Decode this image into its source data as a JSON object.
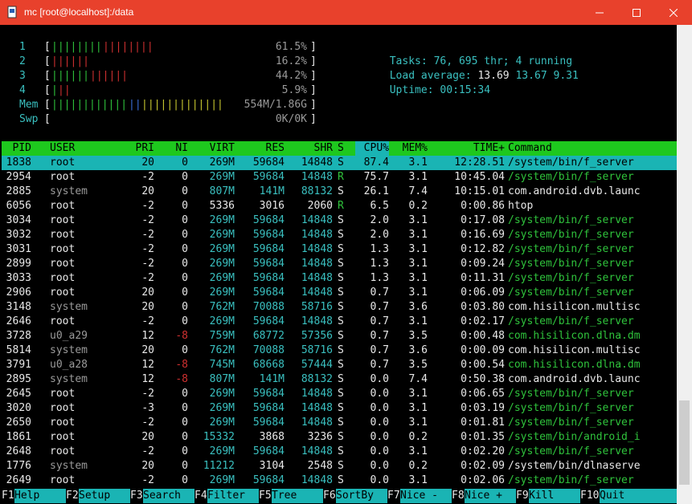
{
  "window": {
    "title": "mc [root@localhost]:/data",
    "icons": [
      "app-icon",
      "minimize-icon",
      "maximize-icon",
      "close-icon"
    ],
    "colors": {
      "titlebar": "#e8412c",
      "header": "#1ec81e",
      "selected": "#1ab4b4"
    }
  },
  "meters": {
    "cpus": [
      {
        "label": "1",
        "green": 8,
        "red": 8,
        "value": "61.5%"
      },
      {
        "label": "2",
        "green": 0,
        "red": 6,
        "value": "16.2%"
      },
      {
        "label": "3",
        "green": 6,
        "red": 6,
        "value": "44.2%"
      },
      {
        "label": "4",
        "green": 1,
        "red": 2,
        "value": "5.9%"
      }
    ],
    "mem": {
      "label": "Mem",
      "value": "554M/1.86G"
    },
    "swp": {
      "label": "Swp",
      "value": "0K/0K"
    }
  },
  "summary": {
    "tasks_label": "Tasks:",
    "tasks": "76,",
    "threads": "695",
    "thr_label": "thr;",
    "running": "4",
    "running_label": "running",
    "load_label": "Load average:",
    "load1": "13.69",
    "load5": "13.67",
    "load15": "9.31",
    "uptime_label": "Uptime:",
    "uptime": "00:15:34"
  },
  "columns": [
    "PID",
    "USER",
    "PRI",
    "NI",
    "VIRT",
    "RES",
    "SHR",
    "S",
    "CPU%",
    "MEM%",
    "TIME+",
    "Command"
  ],
  "processes": [
    [
      "1838",
      "root",
      "20",
      "0",
      "269M",
      "59684",
      "14848",
      "S",
      "87.4",
      "3.1",
      "12:28.51",
      "/system/bin/f_server"
    ],
    [
      "2954",
      "root",
      "-2",
      "0",
      "269M",
      "59684",
      "14848",
      "R",
      "75.7",
      "3.1",
      "10:45.04",
      "/system/bin/f_server"
    ],
    [
      "2885",
      "system",
      "20",
      "0",
      "807M",
      "141M",
      "88132",
      "S",
      "26.1",
      "7.4",
      "10:15.01",
      "com.android.dvb.launc"
    ],
    [
      "6056",
      "root",
      "-2",
      "0",
      "5336",
      "3016",
      "2060",
      "R",
      "6.5",
      "0.2",
      "0:00.86",
      "htop"
    ],
    [
      "3034",
      "root",
      "-2",
      "0",
      "269M",
      "59684",
      "14848",
      "S",
      "2.0",
      "3.1",
      "0:17.08",
      "/system/bin/f_server"
    ],
    [
      "3032",
      "root",
      "-2",
      "0",
      "269M",
      "59684",
      "14848",
      "S",
      "2.0",
      "3.1",
      "0:16.69",
      "/system/bin/f_server"
    ],
    [
      "3031",
      "root",
      "-2",
      "0",
      "269M",
      "59684",
      "14848",
      "S",
      "1.3",
      "3.1",
      "0:12.82",
      "/system/bin/f_server"
    ],
    [
      "2899",
      "root",
      "-2",
      "0",
      "269M",
      "59684",
      "14848",
      "S",
      "1.3",
      "3.1",
      "0:09.24",
      "/system/bin/f_server"
    ],
    [
      "3033",
      "root",
      "-2",
      "0",
      "269M",
      "59684",
      "14848",
      "S",
      "1.3",
      "3.1",
      "0:11.31",
      "/system/bin/f_server"
    ],
    [
      "2906",
      "root",
      "20",
      "0",
      "269M",
      "59684",
      "14848",
      "S",
      "0.7",
      "3.1",
      "0:06.09",
      "/system/bin/f_server"
    ],
    [
      "3148",
      "system",
      "20",
      "0",
      "762M",
      "70088",
      "58716",
      "S",
      "0.7",
      "3.6",
      "0:03.80",
      "com.hisilicon.multisc"
    ],
    [
      "2646",
      "root",
      "-2",
      "0",
      "269M",
      "59684",
      "14848",
      "S",
      "0.7",
      "3.1",
      "0:02.17",
      "/system/bin/f_server"
    ],
    [
      "3728",
      "u0_a29",
      "12",
      "-8",
      "759M",
      "68772",
      "57356",
      "S",
      "0.7",
      "3.5",
      "0:00.48",
      "com.hisilicon.dlna.dm"
    ],
    [
      "5814",
      "system",
      "20",
      "0",
      "762M",
      "70088",
      "58716",
      "S",
      "0.7",
      "3.6",
      "0:00.09",
      "com.hisilicon.multisc"
    ],
    [
      "3791",
      "u0_a28",
      "12",
      "-8",
      "745M",
      "68668",
      "57444",
      "S",
      "0.7",
      "3.5",
      "0:00.54",
      "com.hisilicon.dlna.dm"
    ],
    [
      "2895",
      "system",
      "12",
      "-8",
      "807M",
      "141M",
      "88132",
      "S",
      "0.0",
      "7.4",
      "0:50.38",
      "com.android.dvb.launc"
    ],
    [
      "2645",
      "root",
      "-2",
      "0",
      "269M",
      "59684",
      "14848",
      "S",
      "0.0",
      "3.1",
      "0:06.65",
      "/system/bin/f_server"
    ],
    [
      "3020",
      "root",
      "-3",
      "0",
      "269M",
      "59684",
      "14848",
      "S",
      "0.0",
      "3.1",
      "0:03.19",
      "/system/bin/f_server"
    ],
    [
      "2650",
      "root",
      "-2",
      "0",
      "269M",
      "59684",
      "14848",
      "S",
      "0.0",
      "3.1",
      "0:01.81",
      "/system/bin/f_server"
    ],
    [
      "1861",
      "root",
      "20",
      "0",
      "15332",
      "3868",
      "3236",
      "S",
      "0.0",
      "0.2",
      "0:01.35",
      "/system/bin/android_i"
    ],
    [
      "2648",
      "root",
      "-2",
      "0",
      "269M",
      "59684",
      "14848",
      "S",
      "0.0",
      "3.1",
      "0:02.20",
      "/system/bin/f_server"
    ],
    [
      "1776",
      "system",
      "20",
      "0",
      "11212",
      "3104",
      "2548",
      "S",
      "0.0",
      "0.2",
      "0:02.09",
      "/system/bin/dlnaserve"
    ],
    [
      "2649",
      "root",
      "-2",
      "0",
      "269M",
      "59684",
      "14848",
      "S",
      "0.0",
      "3.1",
      "0:02.06",
      "/system/bin/f_server"
    ]
  ],
  "fkeys": [
    {
      "key": "F1",
      "label": "Help"
    },
    {
      "key": "F2",
      "label": "Setup"
    },
    {
      "key": "F3",
      "label": "Search"
    },
    {
      "key": "F4",
      "label": "Filter"
    },
    {
      "key": "F5",
      "label": "Tree"
    },
    {
      "key": "F6",
      "label": "SortBy"
    },
    {
      "key": "F7",
      "label": "Nice -"
    },
    {
      "key": "F8",
      "label": "Nice +"
    },
    {
      "key": "F9",
      "label": "Kill"
    },
    {
      "key": "F10",
      "label": "Quit"
    }
  ]
}
